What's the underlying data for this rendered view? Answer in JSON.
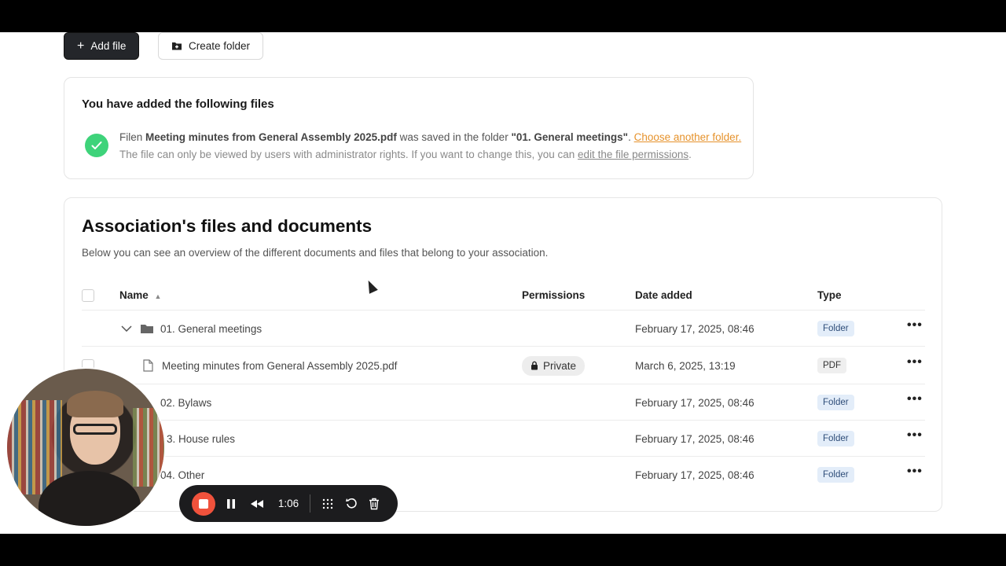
{
  "toolbar": {
    "add_file_label": "Add file",
    "create_folder_label": "Create folder"
  },
  "notice": {
    "title": "You have added the following files",
    "line1_prefix": "Filen ",
    "file_name": "Meeting minutes from General Assembly 2025.pdf",
    "line1_middle": " was saved in the folder ",
    "folder_name": "\"01. General meetings\"",
    "line1_suffix": ". ",
    "choose_folder_link": "Choose another folder.",
    "line2_prefix": "The file can only be viewed by users with administrator rights. If you want to change this, you can ",
    "edit_permissions_link": "edit the file permissions",
    "line2_suffix": "."
  },
  "files": {
    "title": "Association's files and documents",
    "subtitle": "Below you can see an overview of the different documents and files that belong to your association.",
    "columns": {
      "name": "Name",
      "permissions": "Permissions",
      "date": "Date added",
      "type": "Type"
    },
    "rows": [
      {
        "name": "01. General meetings",
        "permission": "",
        "date": "February 17, 2025, 08:46",
        "type": "Folder"
      },
      {
        "name": "Meeting minutes from General Assembly 2025.pdf",
        "permission": "Private",
        "date": "March 6, 2025, 13:19",
        "type": "PDF"
      },
      {
        "name": "02. Bylaws",
        "permission": "",
        "date": "February 17, 2025, 08:46",
        "type": "Folder"
      },
      {
        "name": "3. House rules",
        "permission": "",
        "date": "February 17, 2025, 08:46",
        "type": "Folder"
      },
      {
        "name": "04. Other",
        "permission": "",
        "date": "February 17, 2025, 08:46",
        "type": "Folder"
      }
    ]
  },
  "recorder": {
    "time": "1:06"
  }
}
